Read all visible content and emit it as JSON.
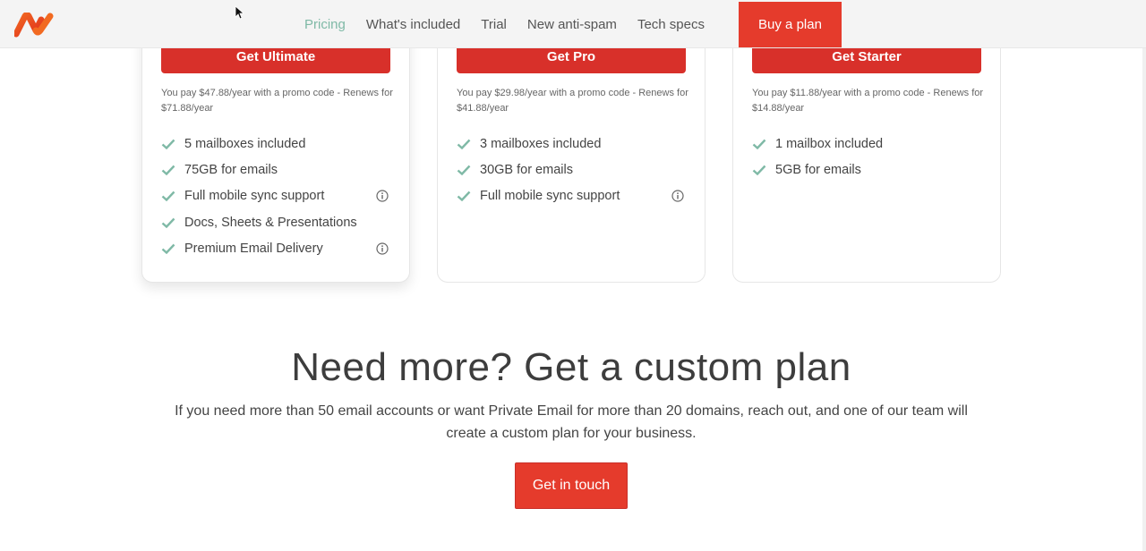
{
  "header": {
    "nav": [
      {
        "label": "Pricing"
      },
      {
        "label": "What's included"
      },
      {
        "label": "Trial"
      },
      {
        "label": "New anti-spam"
      },
      {
        "label": "Tech specs"
      }
    ],
    "buy_label": "Buy a plan"
  },
  "plans": [
    {
      "button": "Get Ultimate",
      "price_note": "You pay $47.88/year with a promo code - Renews for $71.88/year",
      "features": [
        {
          "text": "5 mailboxes included",
          "info": false
        },
        {
          "text": "75GB for emails",
          "info": false
        },
        {
          "text": "Full mobile sync support",
          "info": true
        },
        {
          "text": "Docs, Sheets & Presentations",
          "info": false
        },
        {
          "text": "Premium Email Delivery",
          "info": true
        }
      ]
    },
    {
      "button": "Get Pro",
      "price_note": "You pay $29.98/year with a promo code - Renews for $41.88/year",
      "features": [
        {
          "text": "3 mailboxes included",
          "info": false
        },
        {
          "text": "30GB for emails",
          "info": false
        },
        {
          "text": "Full mobile sync support",
          "info": true
        }
      ]
    },
    {
      "button": "Get Starter",
      "price_note": "You pay $11.88/year with a promo code - Renews for $14.88/year",
      "features": [
        {
          "text": "1 mailbox included",
          "info": false
        },
        {
          "text": "5GB for emails",
          "info": false
        }
      ]
    }
  ],
  "custom_plan": {
    "title": "Need more? Get a custom plan",
    "text": "If you need more than 50 email accounts or want Private Email for more than 20 domains, reach out, and one of our team will create a custom plan for your business.",
    "button": "Get in touch"
  },
  "colors": {
    "brand": "#e53b2c",
    "plan_button": "#d8302a",
    "active_nav": "#7fb9a6",
    "check": "#7fb9a6"
  },
  "icons": {
    "logo": "namecheap-logo",
    "check": "check-icon",
    "info": "info-icon",
    "cursor": "mouse-pointer"
  }
}
